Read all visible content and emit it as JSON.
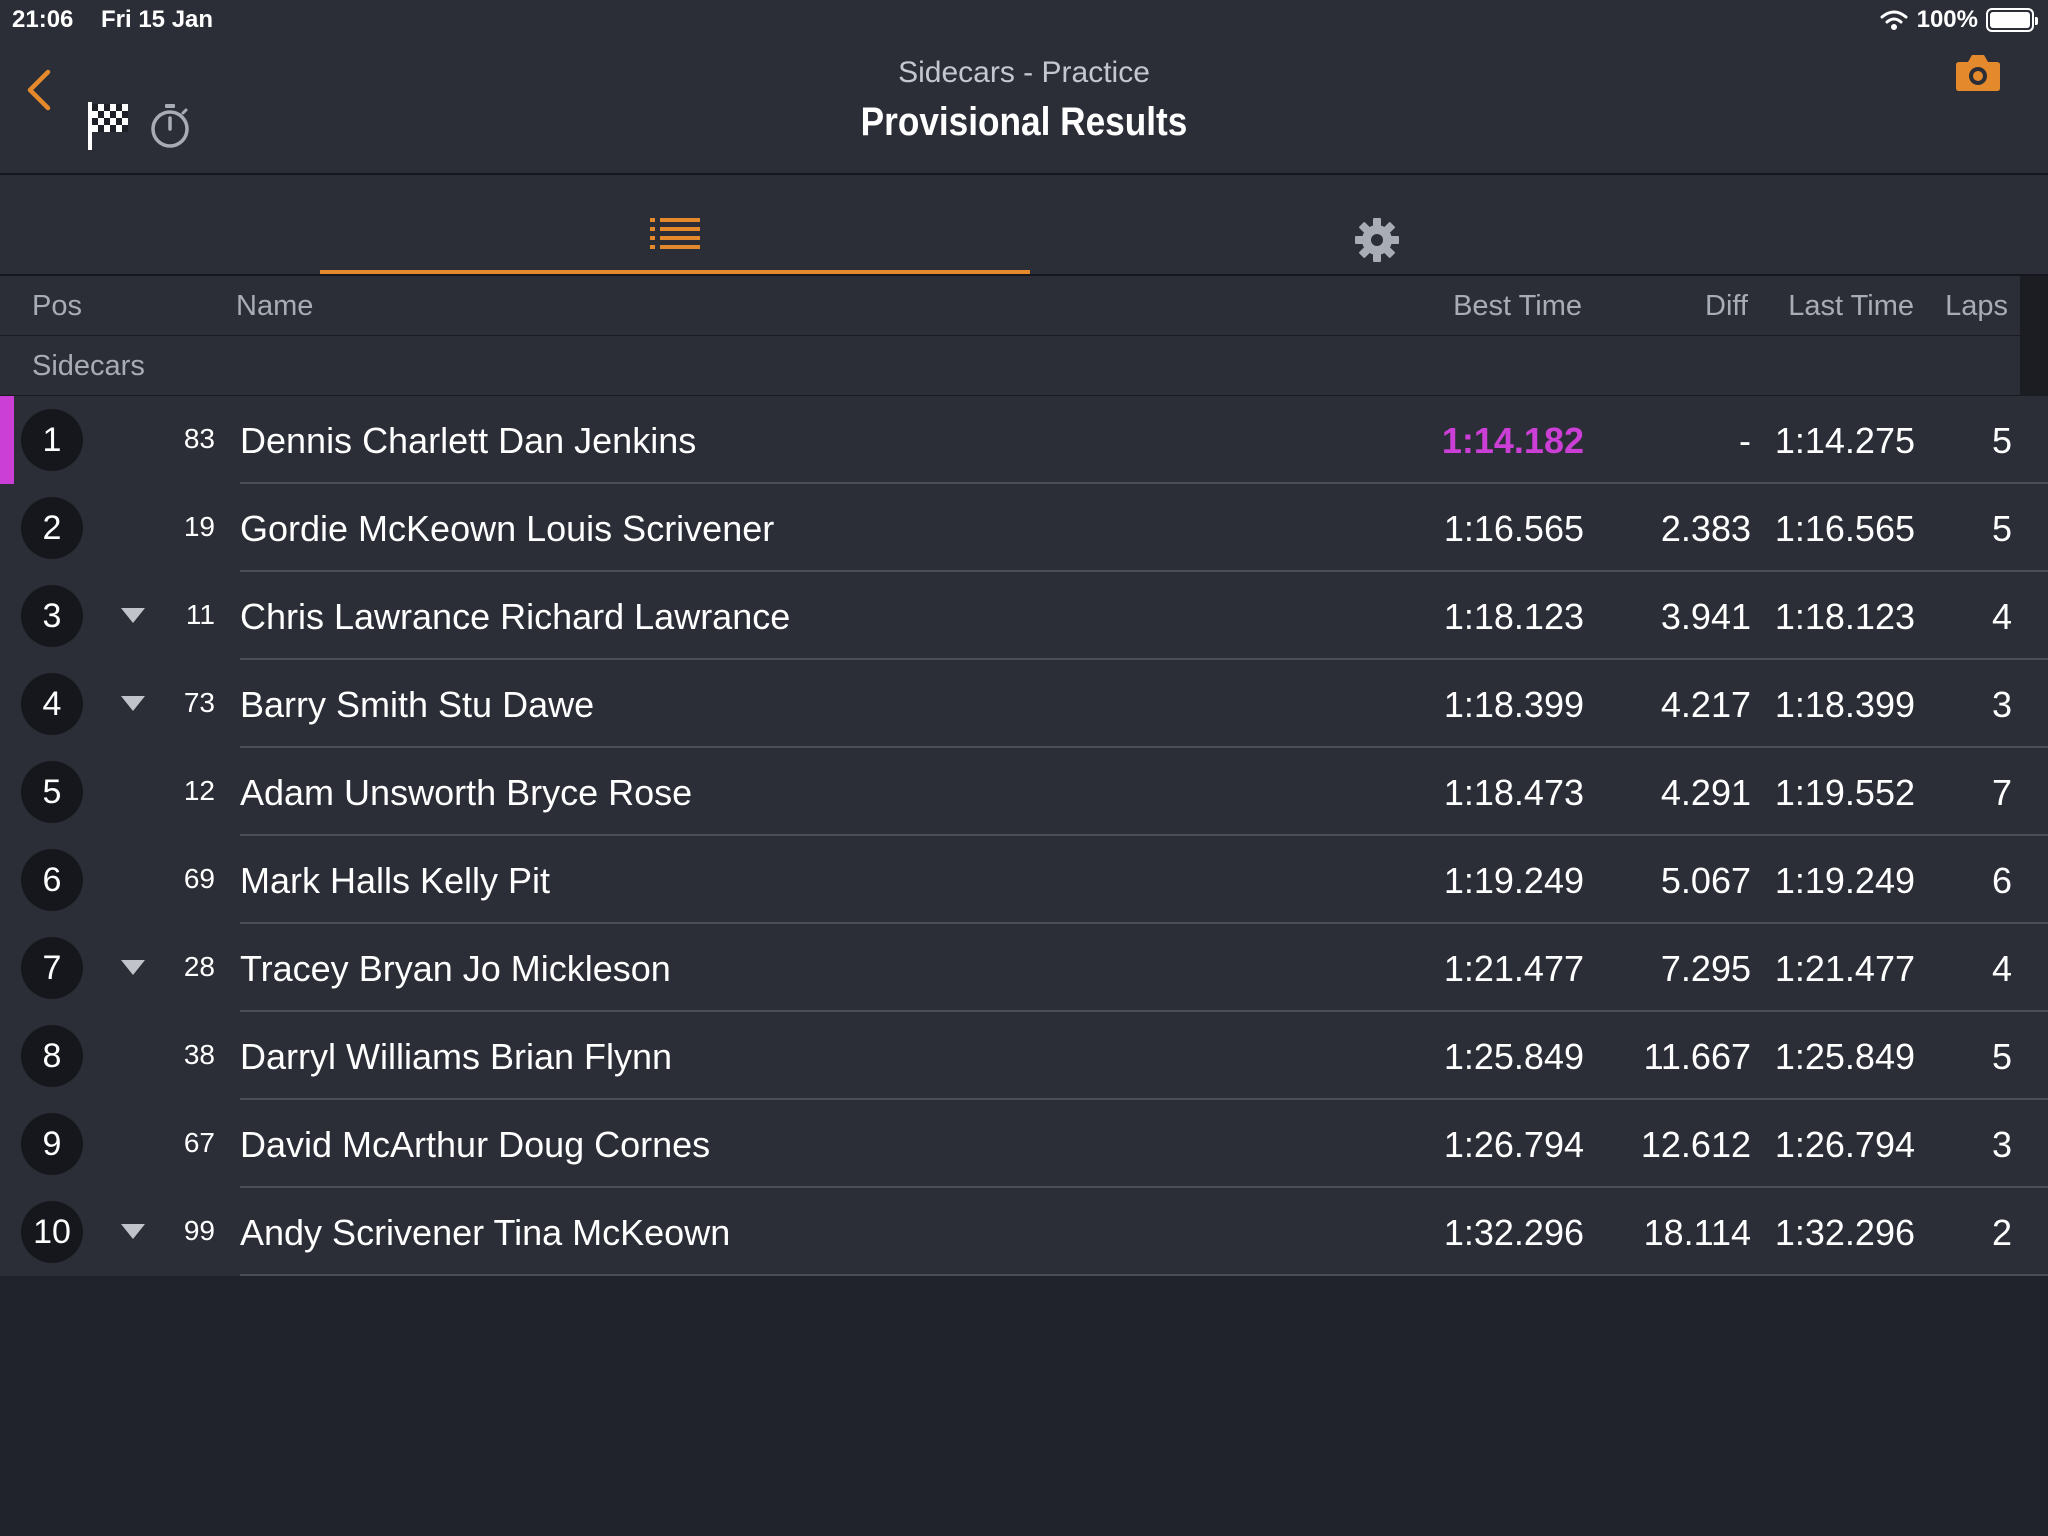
{
  "status": {
    "time": "21:06",
    "date": "Fri 15 Jan",
    "battery": "100%",
    "battery_level": 1.0
  },
  "header": {
    "subtitle": "Sidecars - Practice",
    "title": "Provisional Results",
    "icons": [
      "chevron-left-icon",
      "checkered-flag-icon",
      "stopwatch-icon",
      "camera-icon"
    ]
  },
  "tabs": [
    {
      "icon": "list-icon",
      "selected": true
    },
    {
      "icon": "gear-icon",
      "selected": false
    }
  ],
  "colors": {
    "accent": "#e58a2c",
    "fastest": "#cc3fd6",
    "background": "#20232b",
    "panel": "#2b2e37"
  },
  "table": {
    "headers": {
      "pos": "Pos",
      "name": "Name",
      "best": "Best Time",
      "diff": "Diff",
      "last": "Last Time",
      "laps": "Laps"
    },
    "group": "Sidecars",
    "rows": [
      {
        "pos": "1",
        "car": "83",
        "name": "Dennis Charlett Dan Jenkins",
        "best": "1:14.182",
        "diff": "-",
        "last": "1:14.275",
        "laps": "5",
        "arrow": false,
        "fastest": true
      },
      {
        "pos": "2",
        "car": "19",
        "name": "Gordie McKeown Louis Scrivener",
        "best": "1:16.565",
        "diff": "2.383",
        "last": "1:16.565",
        "laps": "5",
        "arrow": false,
        "fastest": false
      },
      {
        "pos": "3",
        "car": "11",
        "name": "Chris Lawrance Richard Lawrance",
        "best": "1:18.123",
        "diff": "3.941",
        "last": "1:18.123",
        "laps": "4",
        "arrow": true,
        "fastest": false
      },
      {
        "pos": "4",
        "car": "73",
        "name": "Barry Smith Stu Dawe",
        "best": "1:18.399",
        "diff": "4.217",
        "last": "1:18.399",
        "laps": "3",
        "arrow": true,
        "fastest": false
      },
      {
        "pos": "5",
        "car": "12",
        "name": "Adam Unsworth Bryce Rose",
        "best": "1:18.473",
        "diff": "4.291",
        "last": "1:19.552",
        "laps": "7",
        "arrow": false,
        "fastest": false
      },
      {
        "pos": "6",
        "car": "69",
        "name": "Mark Halls Kelly Pit",
        "best": "1:19.249",
        "diff": "5.067",
        "last": "1:19.249",
        "laps": "6",
        "arrow": false,
        "fastest": false
      },
      {
        "pos": "7",
        "car": "28",
        "name": "Tracey Bryan Jo Mickleson",
        "best": "1:21.477",
        "diff": "7.295",
        "last": "1:21.477",
        "laps": "4",
        "arrow": true,
        "fastest": false
      },
      {
        "pos": "8",
        "car": "38",
        "name": "Darryl Williams Brian Flynn",
        "best": "1:25.849",
        "diff": "11.667",
        "last": "1:25.849",
        "laps": "5",
        "arrow": false,
        "fastest": false
      },
      {
        "pos": "9",
        "car": "67",
        "name": "David McArthur Doug Cornes",
        "best": "1:26.794",
        "diff": "12.612",
        "last": "1:26.794",
        "laps": "3",
        "arrow": false,
        "fastest": false
      },
      {
        "pos": "10",
        "car": "99",
        "name": "Andy Scrivener Tina McKeown",
        "best": "1:32.296",
        "diff": "18.114",
        "last": "1:32.296",
        "laps": "2",
        "arrow": true,
        "fastest": false
      }
    ]
  }
}
